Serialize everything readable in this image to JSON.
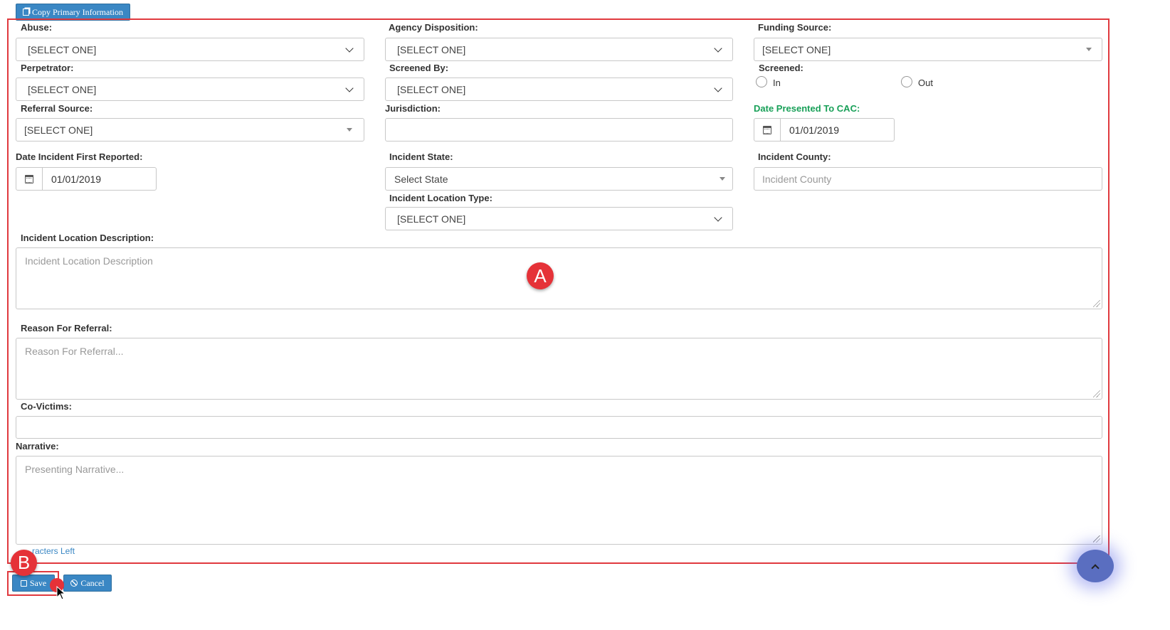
{
  "top_button": {
    "label": "Copy Primary Information",
    "icon": "copy-icon"
  },
  "fields": {
    "abuse": {
      "label": "Abuse:",
      "value": "[SELECT ONE]"
    },
    "agency_disposition": {
      "label": "Agency Disposition:",
      "value": "[SELECT ONE]"
    },
    "funding_source": {
      "label": "Funding Source:",
      "value": "[SELECT ONE]"
    },
    "perpetrator": {
      "label": "Perpetrator:",
      "value": "[SELECT ONE]"
    },
    "screened_by": {
      "label": "Screened By:",
      "value": "[SELECT ONE]"
    },
    "screened": {
      "label": "Screened:",
      "options": [
        "In",
        "Out"
      ]
    },
    "referral_source": {
      "label": "Referral Source:",
      "value": "[SELECT ONE]"
    },
    "jurisdiction": {
      "label": "Jurisdiction:",
      "value": ""
    },
    "date_presented": {
      "label": "Date Presented To CAC:",
      "value": "01/01/2019"
    },
    "date_first_reported": {
      "label": "Date Incident First Reported:",
      "value": "01/01/2019"
    },
    "incident_state": {
      "label": "Incident State:",
      "value": "Select State"
    },
    "incident_county": {
      "label": "Incident County:",
      "placeholder": "Incident County"
    },
    "incident_location_type": {
      "label": "Incident Location Type:",
      "value": "[SELECT ONE]"
    },
    "incident_location_description": {
      "label": "Incident Location Description:",
      "placeholder": "Incident Location Description"
    },
    "reason_for_referral": {
      "label": "Reason For Referral:",
      "placeholder": "Reason For Referral..."
    },
    "co_victims": {
      "label": "Co-Victims:",
      "value": ""
    },
    "narrative": {
      "label": "Narrative:",
      "placeholder": "Presenting Narrative..."
    }
  },
  "chars_left": "racters Left",
  "buttons": {
    "save": "Save",
    "cancel": "Cancel"
  },
  "callouts": {
    "a": "A",
    "b": "B"
  },
  "colors": {
    "accent": "#3a87c4",
    "highlight": "#e0393e",
    "green_label": "#18a058"
  }
}
